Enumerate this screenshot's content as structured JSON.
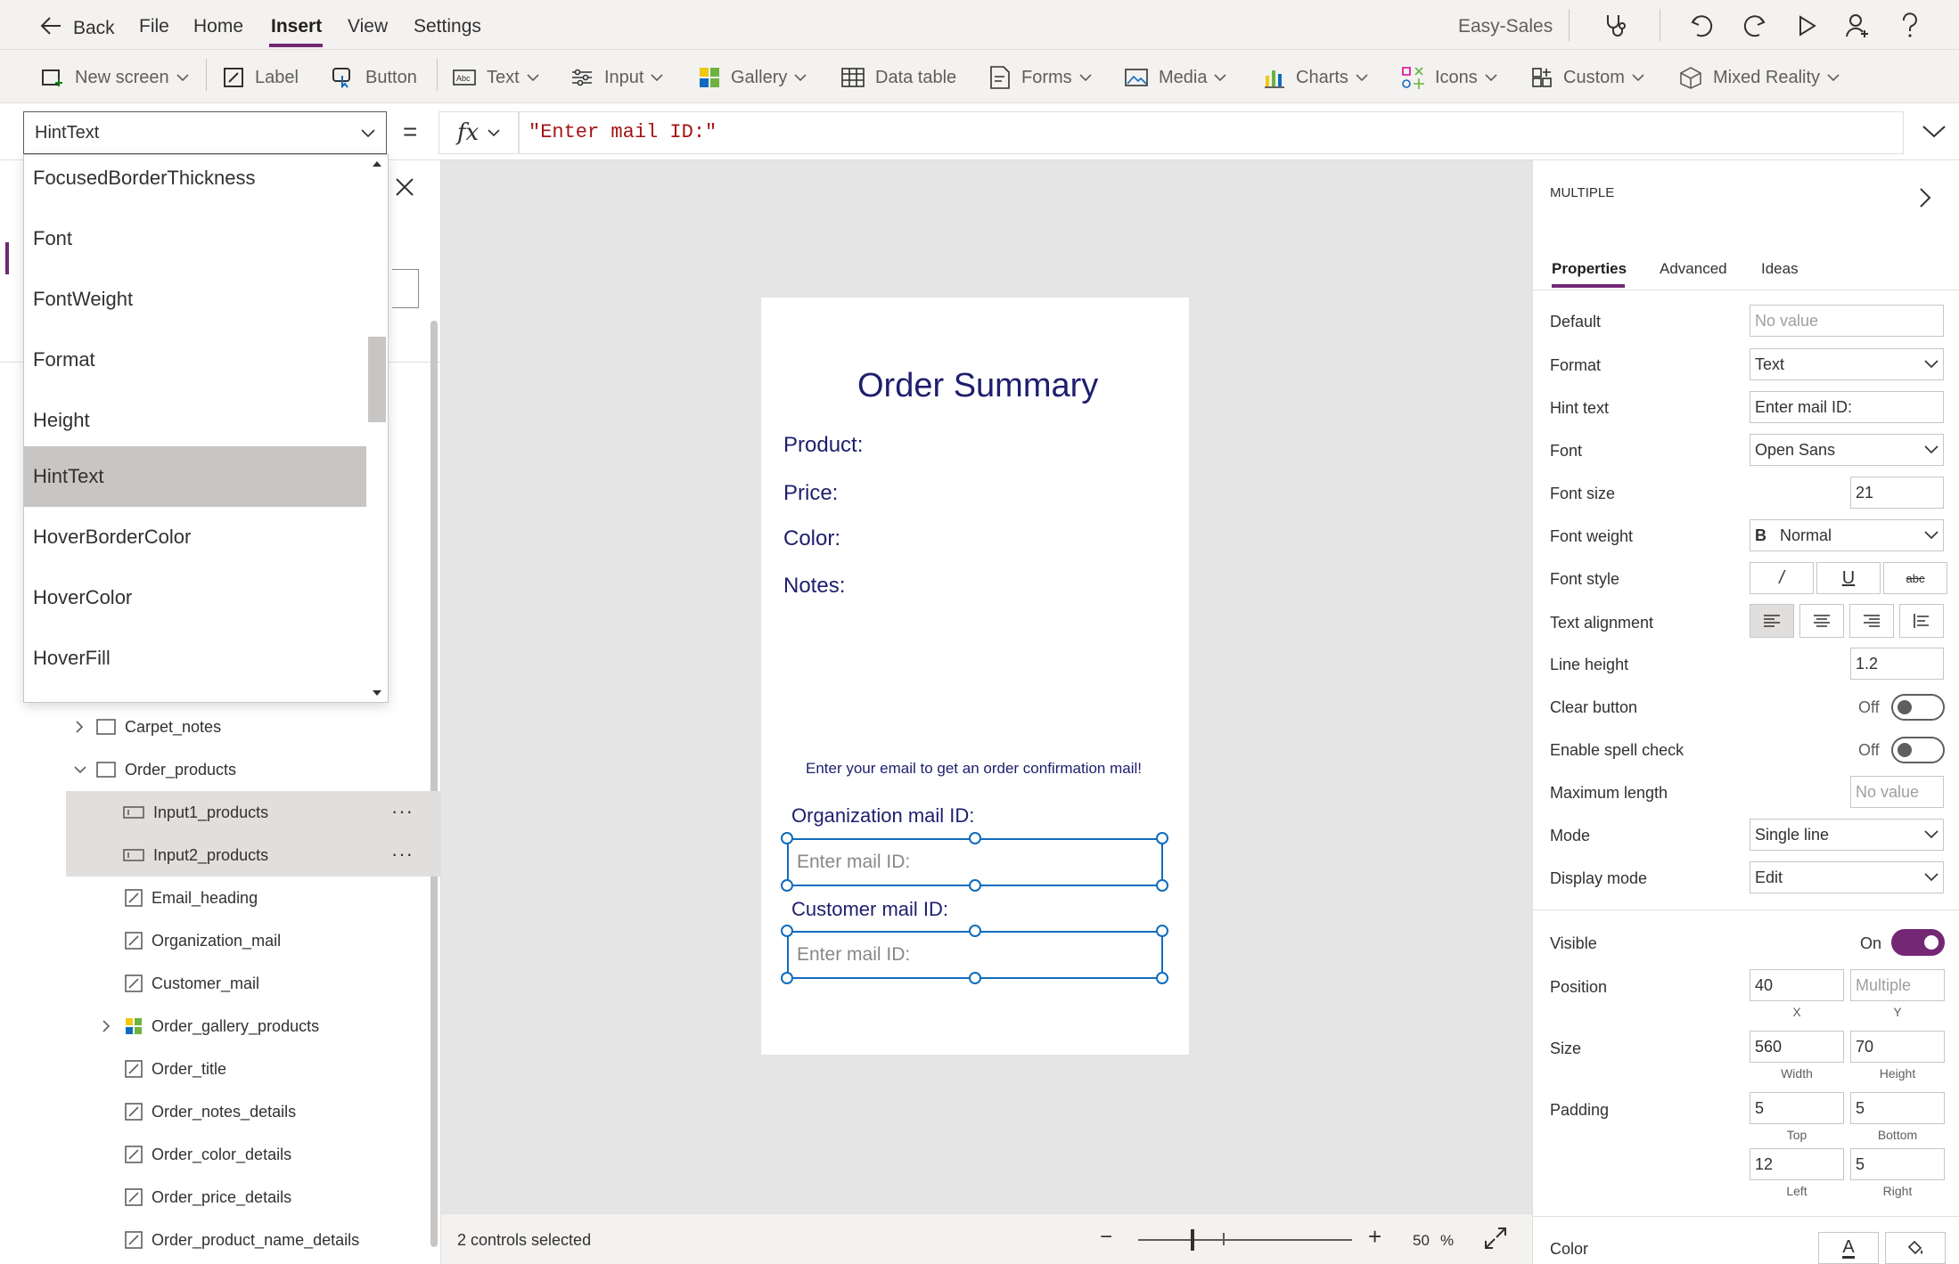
{
  "topbar": {
    "back": "Back",
    "menus": [
      "File",
      "Home",
      "Insert",
      "View",
      "Settings"
    ],
    "app_name": "Easy-Sales"
  },
  "ribbon": {
    "new_screen": "New screen",
    "label": "Label",
    "button": "Button",
    "text": "Text",
    "input": "Input",
    "gallery": "Gallery",
    "data_table": "Data table",
    "forms": "Forms",
    "media": "Media",
    "charts": "Charts",
    "icons": "Icons",
    "custom": "Custom",
    "mixed_reality": "Mixed Reality"
  },
  "formula": {
    "property": "HintText",
    "equals": "=",
    "fx": "fx",
    "expression": "\"Enter mail ID:\""
  },
  "property_dropdown": {
    "items": [
      "FocusedBorderThickness",
      "Font",
      "FontWeight",
      "Format",
      "Height",
      "HintText",
      "HoverBorderColor",
      "HoverColor",
      "HoverFill"
    ],
    "selected": "HintText"
  },
  "tree": {
    "items": [
      {
        "name": "Carpet_notes"
      },
      {
        "name": "Order_products"
      },
      {
        "name": "Input1_products",
        "more": "···"
      },
      {
        "name": "Input2_products",
        "more": "···"
      },
      {
        "name": "Email_heading"
      },
      {
        "name": "Organization_mail"
      },
      {
        "name": "Customer_mail"
      },
      {
        "name": "Order_gallery_products"
      },
      {
        "name": "Order_title"
      },
      {
        "name": "Order_notes_details"
      },
      {
        "name": "Order_color_details"
      },
      {
        "name": "Order_price_details"
      },
      {
        "name": "Order_product_name_details"
      }
    ]
  },
  "screen": {
    "title": "Order Summary",
    "product": "Product:",
    "price": "Price:",
    "color": "Color:",
    "notes": "Notes:",
    "email_heading": "Enter your email to get an order confirmation mail!",
    "org_label": "Organization mail ID:",
    "org_placeholder": "Enter mail ID:",
    "cust_label": "Customer mail ID:",
    "cust_placeholder": "Enter mail ID:"
  },
  "status": {
    "selection": "2 controls selected",
    "zoom": "50",
    "zoom_unit": "%",
    "zoom_minus": "−",
    "zoom_plus": "+"
  },
  "properties_panel": {
    "header": "MULTIPLE",
    "tabs": [
      "Properties",
      "Advanced",
      "Ideas"
    ],
    "default_label": "Default",
    "default_placeholder": "No value",
    "format_label": "Format",
    "format_value": "Text",
    "hint_label": "Hint text",
    "hint_value": "Enter mail ID:",
    "font_label": "Font",
    "font_value": "Open Sans",
    "font_size_label": "Font size",
    "font_size_value": "21",
    "font_weight_label": "Font weight",
    "font_weight_icon": "B",
    "font_weight_value": "Normal",
    "font_style_label": "Font style",
    "font_style_italic": "/",
    "font_style_underline": "U",
    "font_style_strike": "abc",
    "text_alignment_label": "Text alignment",
    "line_height_label": "Line height",
    "line_height_value": "1.2",
    "clear_button_label": "Clear button",
    "clear_button_state": "Off",
    "spell_check_label": "Enable spell check",
    "spell_check_state": "Off",
    "max_length_label": "Maximum length",
    "max_length_placeholder": "No value",
    "mode_label": "Mode",
    "mode_value": "Single line",
    "display_mode_label": "Display mode",
    "display_mode_value": "Edit",
    "visible_label": "Visible",
    "visible_state": "On",
    "position_label": "Position",
    "position_x": "40",
    "position_y_placeholder": "Multiple",
    "x_label": "X",
    "y_label": "Y",
    "size_label": "Size",
    "width_value": "560",
    "height_value": "70",
    "width_label": "Width",
    "height_label": "Height",
    "padding_label": "Padding",
    "padding_top": "5",
    "padding_bottom": "5",
    "padding_left": "12",
    "padding_right": "5",
    "top_label": "Top",
    "bottom_label": "Bottom",
    "left_label": "Left",
    "right_label": "Right",
    "color_label": "Color",
    "color_text_icon": "A"
  },
  "colors": {
    "accent": "#742774",
    "selection_blue": "#0f6cbd",
    "screen_text": "#1e1e6e",
    "formula_string": "#a31515"
  }
}
